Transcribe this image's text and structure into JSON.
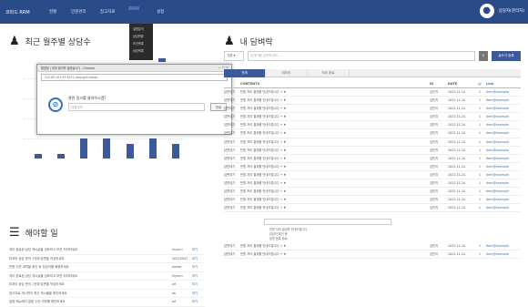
{
  "nav": {
    "brand": "코파드 RRM",
    "items": [
      "현황",
      "민원관리",
      "참고자료",
      "설정"
    ],
    "active_label": "",
    "dropdown": [
      "설명분석",
      "상담현황",
      "조건목록",
      "상담목록"
    ],
    "user_name": "상담자(관리자)"
  },
  "left": {
    "title": "최근 월주별 상담수",
    "legend": "",
    "chart_data": {
      "type": "bar",
      "categories": [
        "",
        "",
        "",
        "",
        "",
        "",
        ""
      ],
      "values": [
        1,
        1,
        4,
        4,
        3,
        4,
        3
      ],
      "ylim": [
        0,
        20
      ]
    },
    "popup": {
      "title": "팝업창 | 외부 링크를 열겠습니다 - Chrome",
      "controls": "— ☐ ✕",
      "url": "225.65.201.93:9012 /popup/Chatrep",
      "question": "관련 링크를 클릭하시겠?",
      "placeholder": "내용입력",
      "button": "전송"
    },
    "list_title": "해야할 일",
    "tasks": [
      {
        "text": "처리 완료된 상담 게시글을 검토하고 보관 처리하세요",
        "who": "Ihyunn",
        "d": "보기"
      },
      {
        "text": "미처리 상담 문의 1건에 답변을 작성하세요",
        "who": "20070507",
        "d": "보기"
      },
      {
        "text": "민원 이관 내역을 확인 후 담당자를 배정하세요",
        "who": "emker",
        "d": "보기"
      },
      {
        "text": "처리 완료된 상담 게시글을 검토하고 보관 처리하세요",
        "who": "Ihyunn",
        "d": "보기"
      },
      {
        "text": "미처리 상담 문의 1건에 답변을 작성하세요",
        "who": "wf",
        "d": "보기"
      },
      {
        "text": "참고자료 게시판의 최신 게시물을 확인하세요",
        "who": "ok",
        "d": "보기"
      },
      {
        "text": "설정 메뉴에서 알림 수신 여부를 확인하세요",
        "who": "wf",
        "d": "보기"
      }
    ]
  },
  "right": {
    "title": "내 담벼락",
    "select": "기본 ▾",
    "search_placeholder": "검색어를 입력하세요",
    "search_icon": "⌕",
    "write_button": "글쓰기 등록",
    "tabs": [
      "전체",
      "미처리",
      "처리 완료"
    ],
    "columns": [
      "",
      "CONTENTS",
      "ID",
      "DATE",
      "☺",
      "Link"
    ],
    "rows": [
      [
        "답변대기",
        "민원 처리 결과를 안내드립니다 → ♦",
        "김민지",
        "2023-11-24",
        "2",
        "item@example"
      ],
      [
        "답변대기",
        "민원 처리 결과를 안내드립니다 → ♦",
        "김민지",
        "2023-11-24",
        "1",
        "item@example"
      ],
      [
        "답변대기",
        "민원 처리 결과를 안내드립니다 → ♦",
        "김민지",
        "2023-11-24",
        "1",
        "item@example"
      ],
      [
        "답변대기",
        "민원 처리 결과를 안내드립니다 → ♦",
        "김민지",
        "2023-11-24",
        "1",
        "item@example"
      ],
      [
        "답변대기",
        "민원 처리 결과를 안내드립니다 → ♦",
        "김민지",
        "2023-11-24",
        "1",
        "item@example"
      ],
      [
        "답변대기",
        "민원 처리 결과를 안내드립니다 → ♦",
        "김민지",
        "2023-11-24",
        "1",
        "item@example"
      ],
      [
        "답변대기",
        "민원 처리 결과를 안내드립니다 → ♦",
        "김민지",
        "2023-11-24",
        "1",
        "item@example"
      ],
      [
        "답변대기",
        "민원 처리 결과를 안내드립니다 → ♦",
        "김민지",
        "2023-11-24",
        "1",
        "item@example"
      ],
      [
        "답변대기",
        "민원 처리 결과를 안내드립니다 → ♦",
        "김민지",
        "2023-11-24",
        "1",
        "item@example"
      ],
      [
        "답변대기",
        "민원 처리 결과를 안내드립니다 → ♦",
        "김민지",
        "2023-11-24",
        "1",
        "item@example"
      ],
      [
        "답변대기",
        "민원 처리 결과를 안내드립니다 → ♦",
        "김민지",
        "2023-11-24",
        "1",
        "item@example"
      ],
      [
        "답변대기",
        "민원 처리 결과를 안내드립니다 → ♦",
        "김민지",
        "2023-11-24",
        "1",
        "item@example"
      ],
      [
        "답변대기",
        "민원 처리 결과를 안내드립니다 → ♦",
        "김민지",
        "2023-11-24",
        "1",
        "item@example"
      ],
      [
        "답변대기",
        "민원 처리 결과를 안내드립니다 → ♦",
        "김민지",
        "2023-11-24",
        "1",
        "item@example"
      ],
      [
        "답변대기",
        "민원 처리 결과를 안내드립니다 → ♦",
        "김민지",
        "2023-11-24",
        "1",
        "item@example"
      ]
    ],
    "reply_lines": [
      "민원 처리 결과를 안내드립니다",
      "담당자 확인 중",
      "답변 등록 완료"
    ],
    "footer_rows": [
      [
        "답변대기",
        "민원 처리 결과를 안내드립니다 → ♦",
        "김민지",
        "2023-11-24",
        "1",
        "item@example"
      ],
      [
        "답변대기",
        "민원 처리 결과를 안내드립니다 → ♦",
        "김민지",
        "2023-11-24",
        "1",
        "item@example"
      ]
    ]
  }
}
